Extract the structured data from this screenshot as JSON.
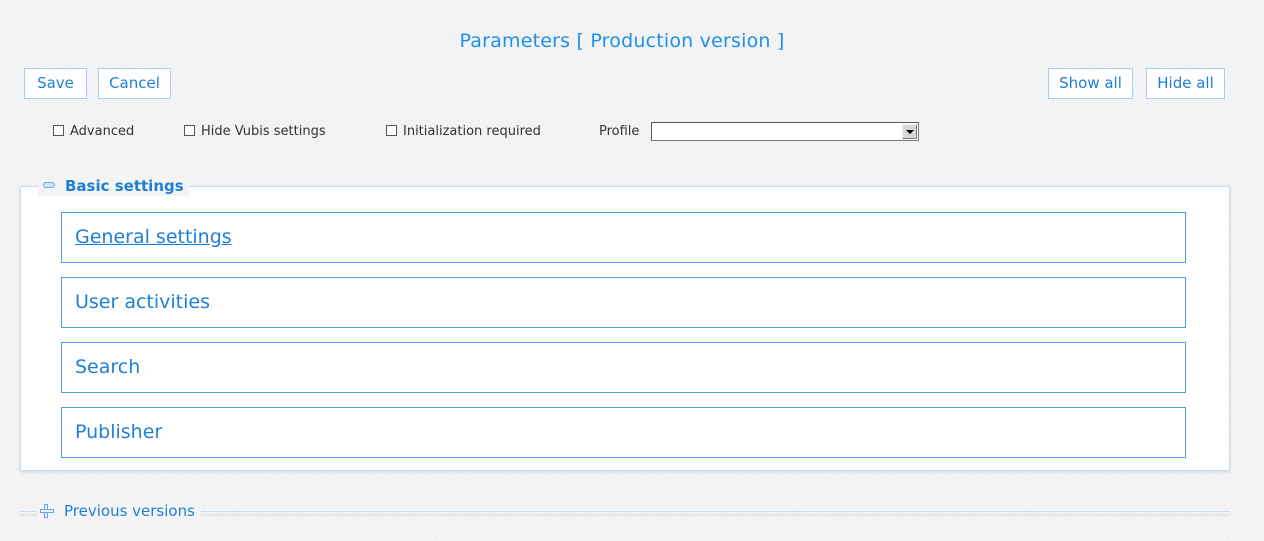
{
  "page": {
    "title": "Parameters [ Production version ]"
  },
  "toolbar": {
    "save_label": "Save",
    "cancel_label": "Cancel",
    "show_all_label": "Show all",
    "hide_all_label": "Hide all"
  },
  "options": {
    "advanced_label": "Advanced",
    "advanced_checked": false,
    "hide_vubis_label": "Hide Vubis settings",
    "hide_vubis_checked": false,
    "init_required_label": "Initialization required",
    "init_required_checked": false,
    "profile_label": "Profile",
    "profile_value": ""
  },
  "basic_settings": {
    "legend": "Basic settings",
    "expanded": true,
    "sections": [
      {
        "label": "General settings"
      },
      {
        "label": "User activities"
      },
      {
        "label": "Search"
      },
      {
        "label": "Publisher"
      }
    ]
  },
  "previous_versions": {
    "legend": "Previous versions",
    "expanded": false
  },
  "colors": {
    "accent": "#1e7fd8",
    "border": "#4f9ee4",
    "background": "#f4f4f4"
  }
}
